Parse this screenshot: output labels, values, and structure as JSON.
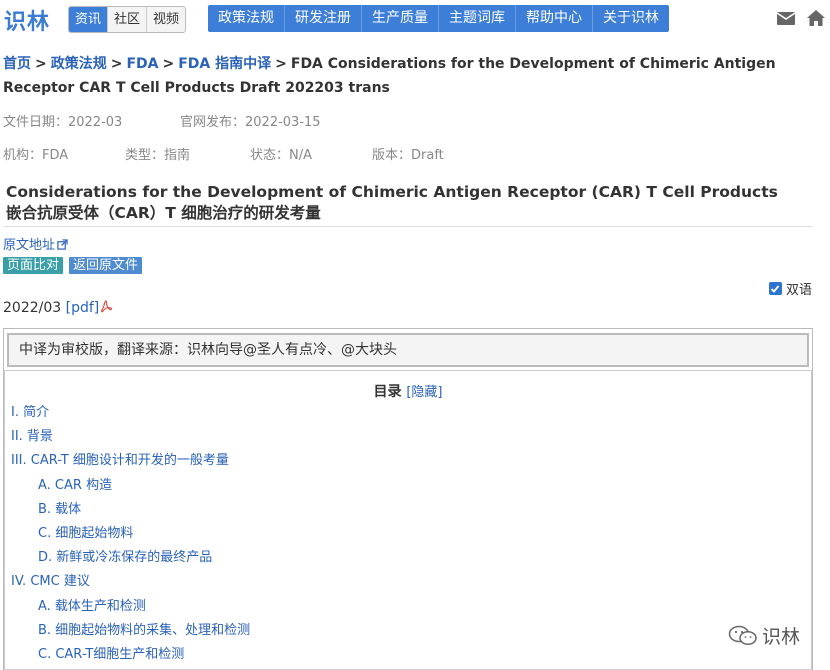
{
  "site": {
    "logo": "识林",
    "subtabs": [
      "资讯",
      "社区",
      "视频"
    ],
    "nav": [
      "政策法规",
      "研发注册",
      "生产质量",
      "主题词库",
      "帮助中心",
      "关于识林"
    ],
    "icons": [
      "mail-icon",
      "home-icon"
    ]
  },
  "breadcrumb": {
    "home": "首页",
    "sep": ">",
    "level1": "政策法规",
    "level2": "FDA",
    "level3": "FDA 指南中译",
    "current": "FDA Considerations for the Development of Chimeric Antigen Receptor CAR T Cell Products Draft 202203 trans"
  },
  "meta": {
    "file_date": "文件日期：2022-03",
    "publish_date": "官网发布：2022-03-15",
    "agency": "机构：FDA",
    "type": "类型：指南",
    "status": "状态：N/A",
    "version": "版本：Draft"
  },
  "document": {
    "title_en": "Considerations for the Development of Chimeric Antigen Receptor (CAR) T Cell Products",
    "title_zh": "嵌合抗原受体（CAR）T 细胞治疗的研发考量",
    "original_link": "原文地址",
    "compare_button": "页面比对",
    "back_button": "返回原文件",
    "bilingual_label": "双语",
    "bilingual_checked": true,
    "date": "2022/03",
    "pdf_link": "[pdf]",
    "translation_note": "中译为审校版，翻译来源：识林向导@圣人有点冷、@大块头"
  },
  "toc": {
    "title": "目录",
    "toggle": "[隐藏]",
    "items": [
      {
        "label": "I. 简介",
        "level": 1
      },
      {
        "label": "II. 背景",
        "level": 1
      },
      {
        "label": "III. CAR-T 细胞设计和开发的一般考量",
        "level": 1
      },
      {
        "label": "A. CAR 构造",
        "level": 2
      },
      {
        "label": "B. 载体",
        "level": 2
      },
      {
        "label": "C. 细胞起始物料",
        "level": 2
      },
      {
        "label": "D. 新鲜或冷冻保存的最终产品",
        "level": 2
      },
      {
        "label": "IV. CMC 建议",
        "level": 1
      },
      {
        "label": "A. 载体生产和检测",
        "level": 2
      },
      {
        "label": "B. 细胞起始物料的采集、处理和检测",
        "level": 2
      },
      {
        "label": "C. CAR-T细胞生产和检测",
        "level": 2
      }
    ]
  },
  "watermark": "识林",
  "colors": {
    "brand_blue": "#3d7ed8",
    "link_blue": "#2a62b8",
    "teal_button": "#3aa0a8"
  }
}
